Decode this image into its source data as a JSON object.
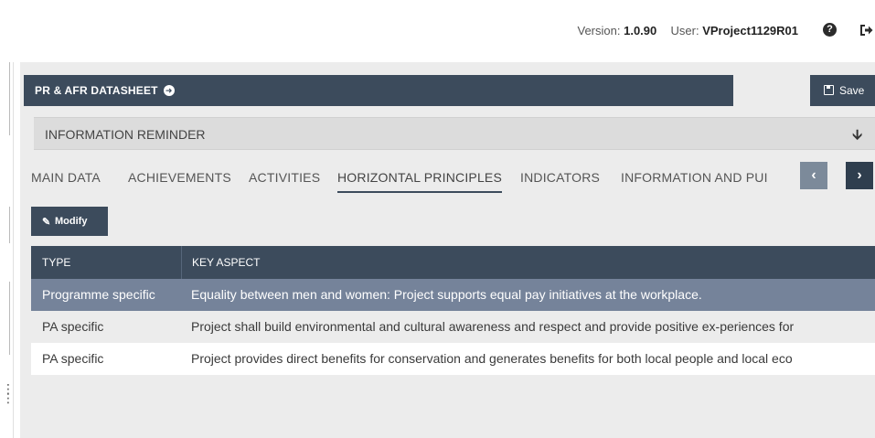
{
  "header": {
    "version_label": "Version:",
    "version_value": "1.0.90",
    "user_label": "User:",
    "user_value": "VProject1129R01"
  },
  "panel": {
    "title": "PR & AFR DATASHEET",
    "save_label": "Save",
    "reminder_label": "INFORMATION REMINDER",
    "modify_label": "Modify"
  },
  "tabs": [
    {
      "label": "MAIN DATA"
    },
    {
      "label": "ACHIEVEMENTS"
    },
    {
      "label": "ACTIVITIES"
    },
    {
      "label": "HORIZONTAL PRINCIPLES",
      "active": true
    },
    {
      "label": "INDICATORS"
    },
    {
      "label": "INFORMATION AND PUI"
    }
  ],
  "table": {
    "columns": [
      "TYPE",
      "KEY ASPECT"
    ],
    "rows": [
      {
        "type": "Programme specific",
        "key_aspect": "Equality between men and women: Project supports equal pay initiatives at the workplace.",
        "selected": true
      },
      {
        "type": "PA specific",
        "key_aspect": "Project shall build environmental and cultural awareness and respect and provide positive ex-periences for"
      },
      {
        "type": "PA specific",
        "key_aspect": "Project provides direct benefits for conservation and generates benefits for both local people and local eco"
      }
    ]
  },
  "icons": {
    "help": "question-circle-icon",
    "logout": "sign-out-icon",
    "title_arrow": "arrow-circle-right-icon",
    "save": "floppy-disk-icon",
    "reminder_toggle": "arrow-down-icon",
    "modify": "pencil-icon",
    "prev": "chevron-left-icon",
    "next": "chevron-right-icon"
  },
  "colors": {
    "primary": "#3c4b5c",
    "selected_row": "#75839a",
    "panel_bg": "#ececec"
  }
}
